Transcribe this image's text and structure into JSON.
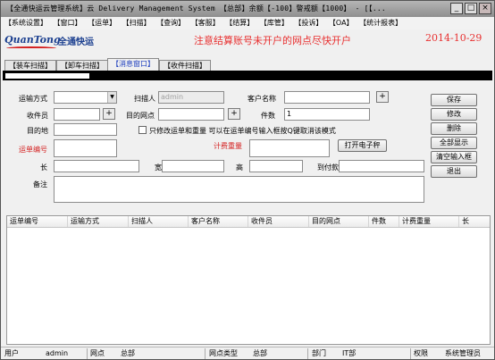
{
  "window": {
    "title": "【全通快运云管理系统】云 Delivery Management System 【总部】余额【-100】警戒额【1000】 - [【...",
    "minimize_icon": "minimize-icon",
    "maximize_icon": "maximize-icon",
    "close_icon": "close-icon"
  },
  "menu": [
    "【系统设置】",
    "【窗口】",
    "【运单】",
    "【扫描】",
    "【查询】",
    "【客服】",
    "【结算】",
    "【库管】",
    "【投诉】",
    "【OA】",
    "【统计报表】"
  ],
  "banner": {
    "logo_text": "QuanTong",
    "logo_cn": "全通快运",
    "notice": "注意结算账号未开户的网点尽快开户",
    "date": "2014-10-29"
  },
  "tabs": [
    {
      "label": "【装车扫描】",
      "active": false
    },
    {
      "label": "【卸车扫描】",
      "active": false
    },
    {
      "label": "【消息窗口】",
      "active": true
    },
    {
      "label": "【收件扫描】",
      "active": false
    }
  ],
  "form": {
    "transport_label": "运输方式",
    "transport_value": "",
    "scanner_label": "扫描人",
    "scanner_value": "admin",
    "customer_label": "客户名称",
    "customer_value": "",
    "courier_label": "收件员",
    "courier_value": "",
    "dest_point_label": "目的网点",
    "dest_point_value": "",
    "pieces_label": "件数",
    "pieces_value": "1",
    "destination_label": "目的地",
    "destination_value": "",
    "modify_only_label": "只修改运单和重量 可以在运单编号输入框按Q键取消该模式",
    "waybill_label": "运单编号",
    "waybill_value": "",
    "weight_label": "计费重量",
    "weight_value": "",
    "open_scale_label": "打开电子秤",
    "length_label": "长",
    "width_label": "宽",
    "height_label": "高",
    "cod_label": "到付款",
    "remark_label": "备注"
  },
  "buttons": {
    "save": "保存",
    "modify": "修改",
    "delete": "删除",
    "show_all": "全部显示",
    "clear_input": "清空输入框",
    "exit": "退出"
  },
  "grid": {
    "columns": [
      "运单编号",
      "运输方式",
      "扫描人",
      "客户名称",
      "收件员",
      "目的网点",
      "件数",
      "计费重量",
      "长"
    ],
    "rows": []
  },
  "status": {
    "user_label": "用户",
    "user_value": "admin",
    "point_label": "网点",
    "point_value": "总部",
    "point_type_label": "网点类型",
    "point_type_value": "总部",
    "dept_label": "部门",
    "dept_value": "IT部",
    "perm_label": "权限",
    "perm_value": "系统管理员"
  }
}
